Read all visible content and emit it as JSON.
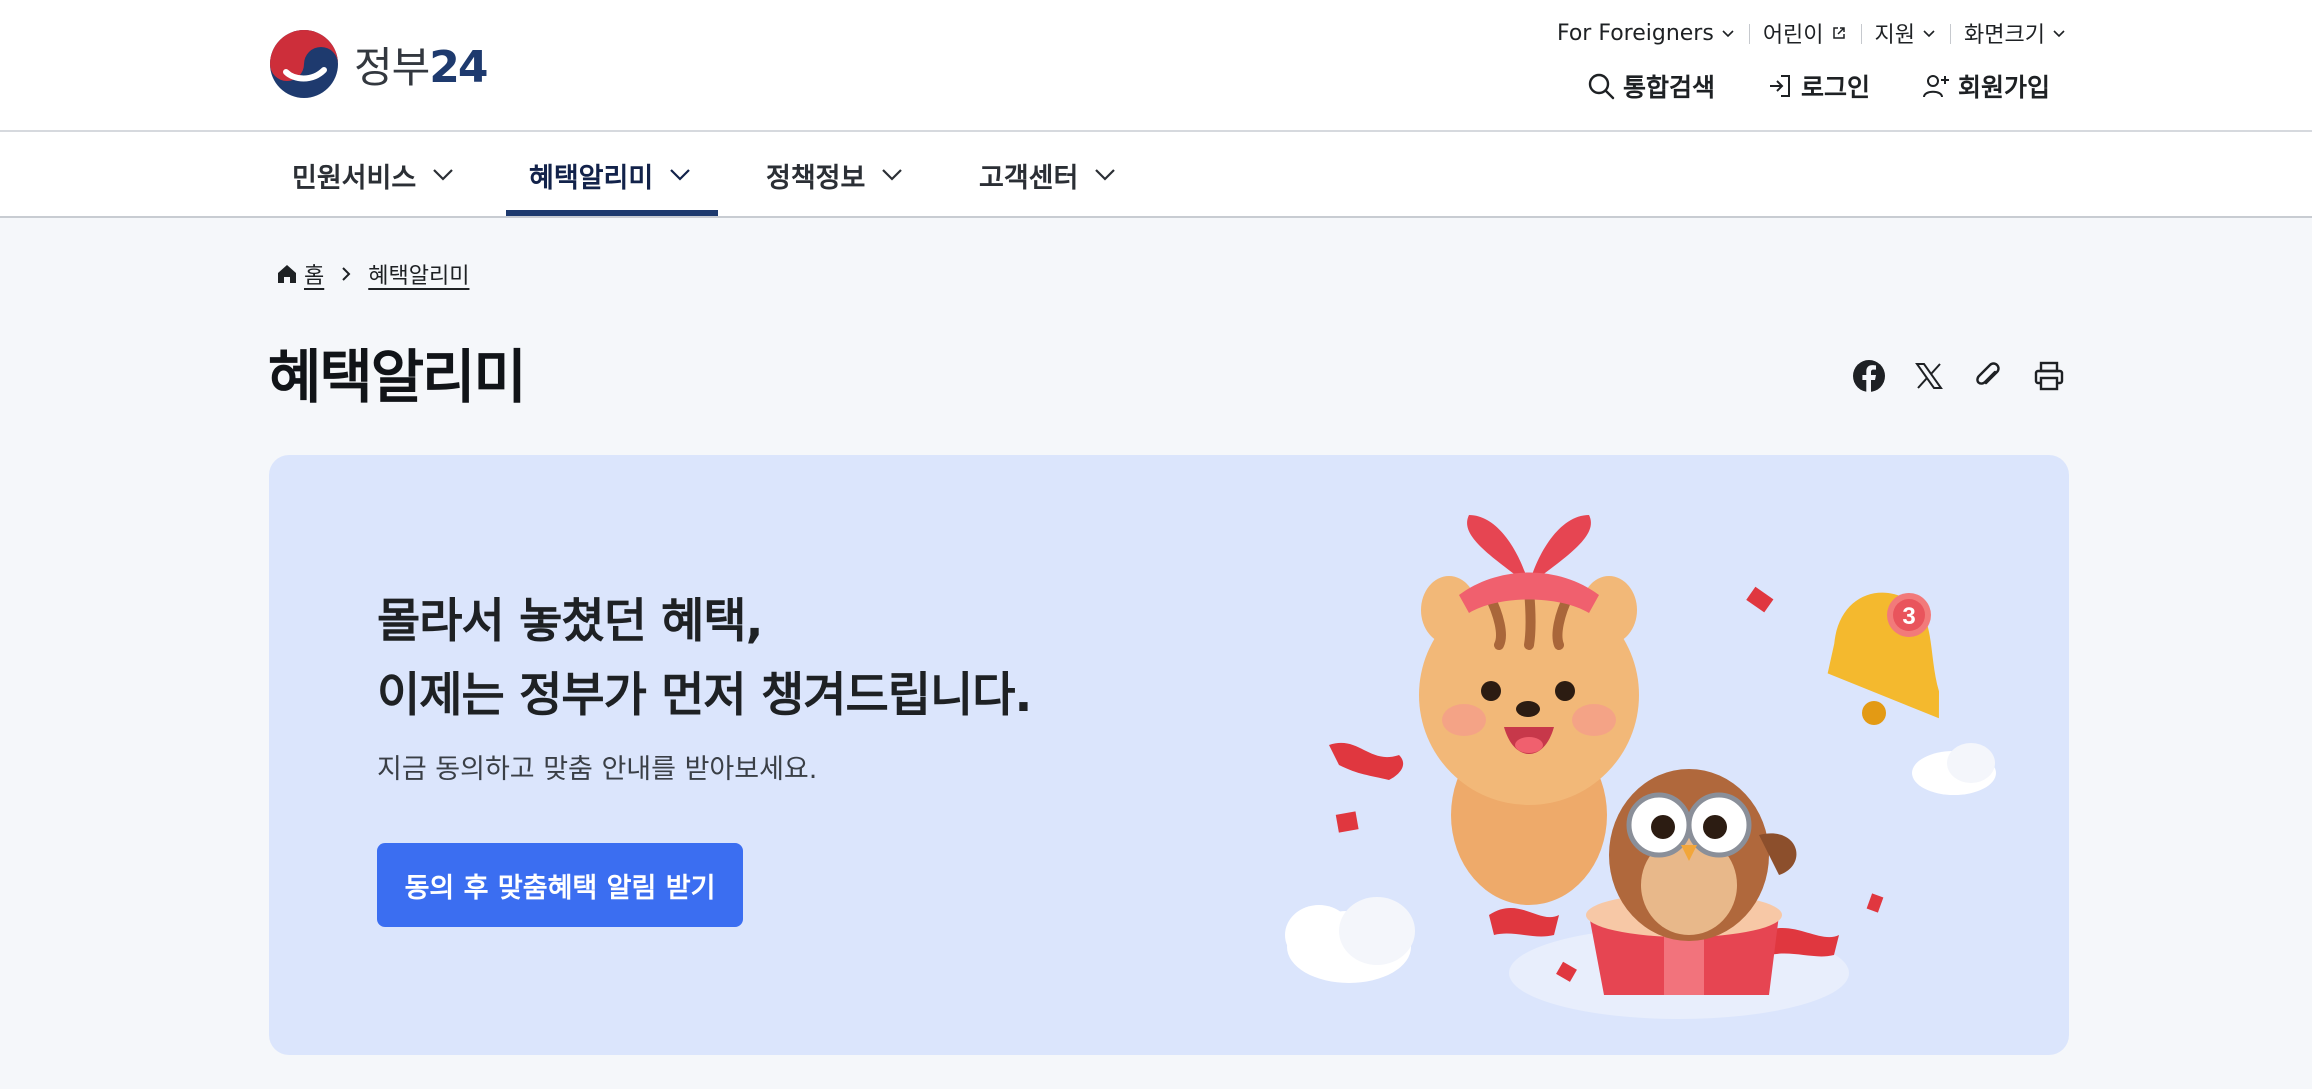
{
  "header": {
    "logo_text": "정부",
    "logo_number": "24",
    "utility": [
      {
        "label": "For Foreigners",
        "icon": "chevron-down-icon"
      },
      {
        "label": "어린이",
        "icon": "external-link-icon"
      },
      {
        "label": "지원",
        "icon": "chevron-down-icon"
      },
      {
        "label": "화면크기",
        "icon": "chevron-down-icon"
      }
    ],
    "user_menu": {
      "search": "통합검색",
      "login": "로그인",
      "signup": "회원가입"
    }
  },
  "gnb": {
    "items": [
      {
        "label": "민원서비스"
      },
      {
        "label": "혜택알리미"
      },
      {
        "label": "정책정보"
      },
      {
        "label": "고객센터"
      }
    ],
    "active_index": 1
  },
  "breadcrumb": {
    "home": "홈",
    "current": "혜택알리미"
  },
  "page": {
    "title": "혜택알리미"
  },
  "share_icons": [
    "facebook-icon",
    "x-icon",
    "link-clip-icon",
    "print-icon"
  ],
  "hero": {
    "title_line1": "몰라서 놓쳤던 혜택,",
    "title_line2": "이제는 정부가 먼저 챙겨드립니다.",
    "subtitle": "지금 동의하고 맞춤 안내를 받아보세요.",
    "button_label": "동의 후 맞춤혜택 알림 받기",
    "bell_badge": "3"
  },
  "colors": {
    "primary_navy": "#1e3a6e",
    "button_blue": "#3b6ef1",
    "hero_bg": "#dbe5fc",
    "page_bg": "#f5f7fa"
  }
}
